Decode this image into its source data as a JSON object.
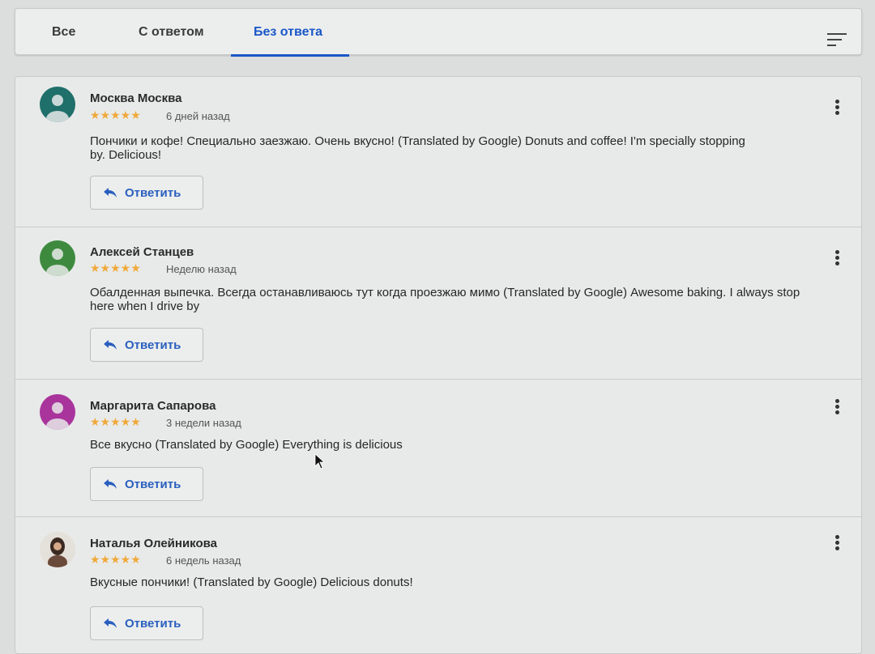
{
  "tabs": {
    "all": "Все",
    "replied": "С ответом",
    "unreplied": "Без ответа",
    "active": "unreplied"
  },
  "icons": {
    "filter": "filter-list-icon",
    "more": "more-vert-icon",
    "reply": "reply-arrow-icon"
  },
  "colors": {
    "accent": "#1a56c8",
    "star": "#f0a93a"
  },
  "reviews": [
    {
      "name": "Москва Москва",
      "stars": "★★★★★",
      "when": "6 дней назад",
      "text": "Пончики и кофе! Специально заезжаю. Очень вкусно! (Translated by Google) Donuts and coffee! I'm specially stopping by. Delicious!",
      "reply_label": "Ответить",
      "avatar_color": "#1f6f6a"
    },
    {
      "name": "Алексей Станцев",
      "stars": "★★★★★",
      "when": "Неделю назад",
      "text": "Обалденная выпечка. Всегда останавливаюсь тут когда проезжаю мимо (Translated by Google) Awesome baking. I always stop here when I drive by",
      "reply_label": "Ответить",
      "avatar_color": "#3d8a3f"
    },
    {
      "name": "Маргарита Сапарова",
      "stars": "★★★★★",
      "when": "3 недели назад",
      "text": "Все вкусно (Translated by Google) Everything is delicious",
      "reply_label": "Ответить",
      "avatar_color": "#a8349c"
    },
    {
      "name": "Наталья Олейникова",
      "stars": "★★★★★",
      "when": "6 недель назад",
      "text": "Вкусные пончики! (Translated by Google) Delicious donuts!",
      "reply_label": "Ответить",
      "avatar_color": "#6a4a3a"
    }
  ]
}
